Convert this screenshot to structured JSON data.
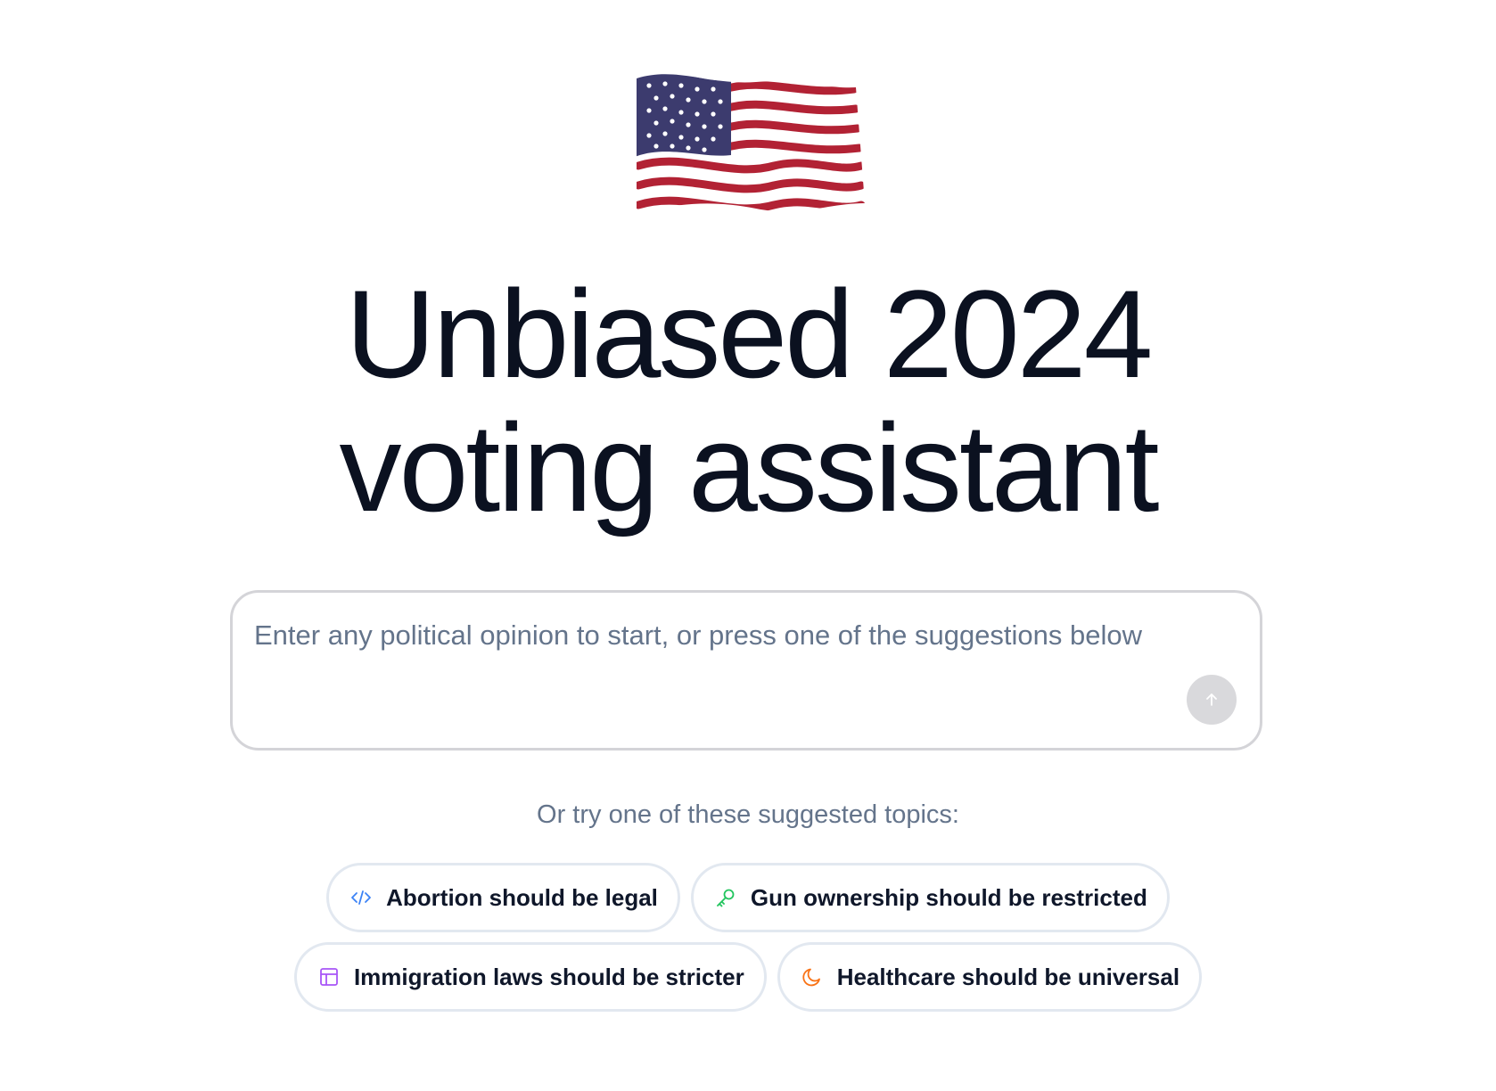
{
  "hero": {
    "logo_icon": "us-flag-icon",
    "title_line1": "Unbiased 2024",
    "title_line2": "voting assistant"
  },
  "prompt": {
    "placeholder": "Enter any political opinion to start, or press one of the suggestions below",
    "value": "",
    "send_icon": "arrow-up-icon"
  },
  "suggestions": {
    "heading": "Or try one of these suggested topics:",
    "items": [
      {
        "label": "Abortion should be legal",
        "icon": "code-icon",
        "color": "#3b82f6"
      },
      {
        "label": "Gun ownership should be restricted",
        "icon": "key-icon",
        "color": "#22c55e"
      },
      {
        "label": "Immigration laws should be stricter",
        "icon": "layout-icon",
        "color": "#a855f7"
      },
      {
        "label": "Healthcare should be universal",
        "icon": "moon-icon",
        "color": "#f97316"
      }
    ]
  },
  "colors": {
    "flag_red": "#b22234",
    "flag_blue": "#3c3b6e",
    "border": "#e2e8f0",
    "muted_text": "#64748b",
    "send_button_disabled": "#d9d9dc"
  }
}
